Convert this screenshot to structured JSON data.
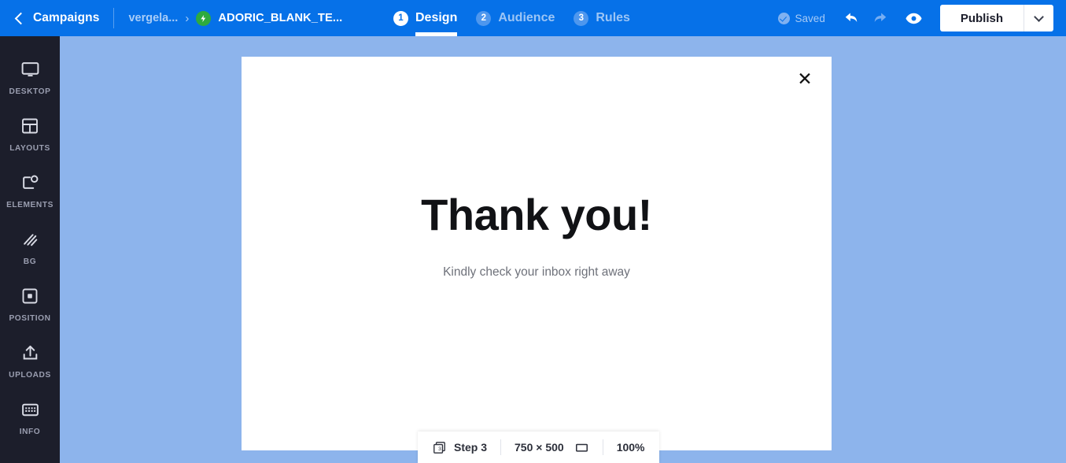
{
  "topbar": {
    "back_icon": "chevron-left-icon",
    "campaigns_label": "Campaigns",
    "site_crumb": "vergela...",
    "crumb_separator": "›",
    "bolt_icon": "lightning-bolt-icon",
    "campaign_name": "ADORIC_BLANK_TE...",
    "saved_label": "Saved",
    "saved_icon": "check-circle-icon",
    "undo_icon": "undo-arrow-icon",
    "redo_icon": "redo-arrow-icon",
    "preview_icon": "eye-icon",
    "publish_label": "Publish",
    "publish_caret_icon": "chevron-down-icon",
    "background_color": "#0671e8"
  },
  "steps": [
    {
      "number": "1",
      "label": "Design",
      "active": true
    },
    {
      "number": "2",
      "label": "Audience",
      "active": false
    },
    {
      "number": "3",
      "label": "Rules",
      "active": false
    }
  ],
  "sidebar": {
    "background_color": "#1c1e2b",
    "items": [
      {
        "label": "DESKTOP",
        "icon": "monitor-icon"
      },
      {
        "label": "LAYOUTS",
        "icon": "layout-grid-icon"
      },
      {
        "label": "ELEMENTS",
        "icon": "elements-shapes-icon"
      },
      {
        "label": "BG",
        "icon": "diagonal-stripes-icon"
      },
      {
        "label": "POSITION",
        "icon": "position-square-icon"
      },
      {
        "label": "UPLOADS",
        "icon": "upload-arrow-icon"
      },
      {
        "label": "INFO",
        "icon": "keyboard-info-icon"
      }
    ]
  },
  "canvas": {
    "background_color": "#8db4ec",
    "modal": {
      "close_icon": "close-x-icon",
      "heading": "Thank you!",
      "subtext": "Kindly check your inbox right away",
      "background_color": "#ffffff"
    }
  },
  "statusbar": {
    "step_icon": "layers-step-icon",
    "step_label": "Step 3",
    "dimensions": "750 × 500",
    "resize_icon": "rectangle-resize-icon",
    "zoom_level": "100%"
  }
}
